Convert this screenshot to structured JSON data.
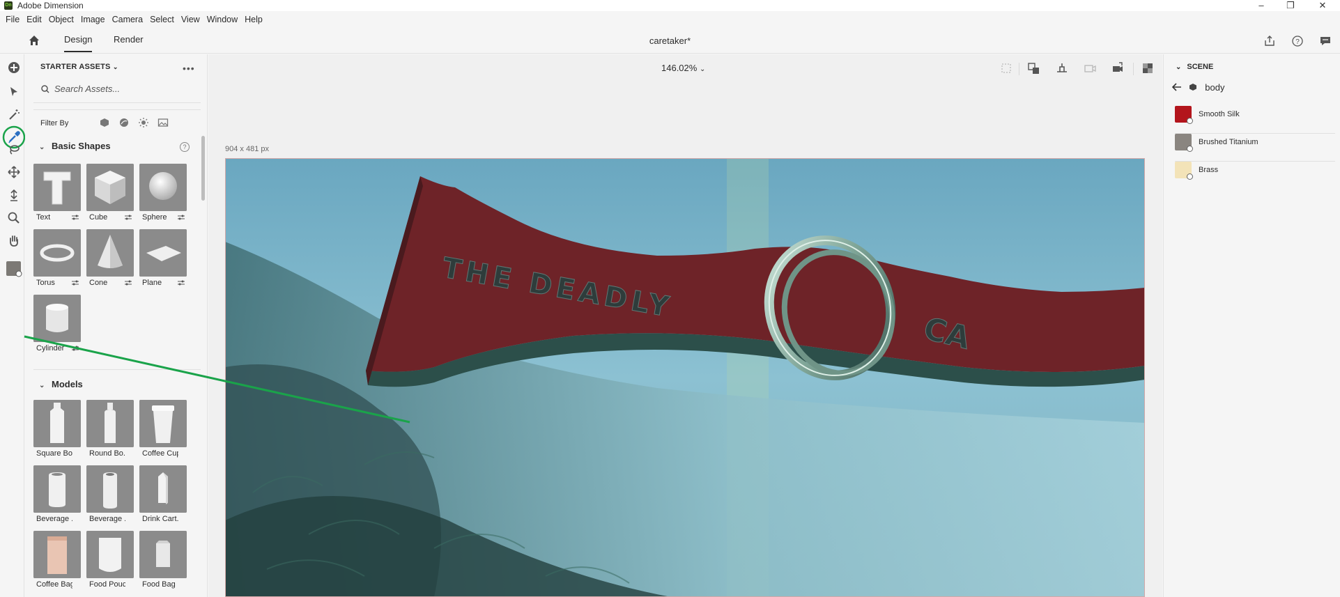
{
  "window": {
    "title": "Adobe Dimension",
    "logo": "Dn",
    "minimize": "–",
    "restore": "❐",
    "close": "✕"
  },
  "menu": [
    "File",
    "Edit",
    "Object",
    "Image",
    "Camera",
    "Select",
    "View",
    "Window",
    "Help"
  ],
  "header": {
    "tabs": [
      "Design",
      "Render"
    ],
    "active_tab": "Design",
    "document": "caretaker*"
  },
  "assets": {
    "title": "STARTER ASSETS",
    "search_placeholder": "Search Assets...",
    "filter_label": "Filter By",
    "basic_shapes": {
      "title": "Basic Shapes",
      "items": [
        "Text",
        "Cube",
        "Sphere",
        "Torus",
        "Cone",
        "Plane",
        "Cylinder"
      ]
    },
    "models": {
      "title": "Models",
      "items": [
        "Square Bo...",
        "Round Bo...",
        "Coffee Cup",
        "Beverage ...",
        "Beverage ...",
        "Drink Cart...",
        "Coffee Bag",
        "Food Pouch",
        "Food Bag"
      ]
    }
  },
  "canvas": {
    "zoom": "146.02%",
    "dimensions": "904 x 481 px",
    "banner_text": "THE DEADLY",
    "banner_text_2": "CA"
  },
  "scene": {
    "title": "SCENE",
    "object": "body",
    "materials": [
      {
        "name": "Smooth Silk",
        "color": "#b3151c"
      },
      {
        "name": "Brushed Titanium",
        "color": "#8a8580"
      },
      {
        "name": "Brass",
        "color": "#f3e3b8"
      }
    ]
  },
  "colors": {
    "accent_green": "#1aa34a",
    "banner_red": "#6e2328",
    "sky": "#7ab8cc"
  }
}
